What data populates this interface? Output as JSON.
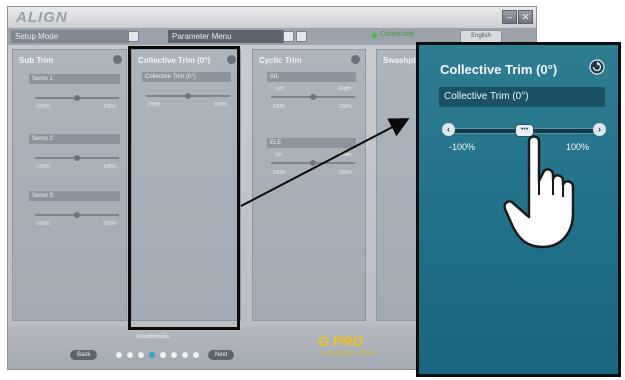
{
  "app": {
    "logo": "ALIGN",
    "window_minimize": "–",
    "window_close": "✕"
  },
  "tabs": [
    {
      "label": "Setup Mode"
    },
    {
      "label": "Parameter Menu"
    }
  ],
  "status": {
    "label": "Connected",
    "button": "English"
  },
  "panels": {
    "subtrim": {
      "title": "Sub Trim",
      "servos": [
        {
          "label": "Servo 1",
          "min": "-100%",
          "max": "100%"
        },
        {
          "label": "Servo 2",
          "min": "-100%",
          "max": "100%"
        },
        {
          "label": "Servo 3",
          "min": "-100%",
          "max": "100%"
        }
      ]
    },
    "collective": {
      "title": "Collective Trim (0°)",
      "field": "Collective Trim (0°)",
      "min": "-100%",
      "max": "100%"
    },
    "cyclic": {
      "title": "Cyclic Trim",
      "groups": [
        {
          "label": "AIL",
          "left": "Left",
          "right": "Right",
          "min": "-100%",
          "max": "100%"
        },
        {
          "label": "ELE",
          "left": "Up",
          "right": "Down",
          "min": "-100%",
          "max": "100%"
        }
      ]
    },
    "setup": {
      "title": "Swashplate"
    }
  },
  "footer": {
    "caption": "Select/Initialize",
    "back": "Back",
    "next": "Next",
    "page_count": 8,
    "current_page": 4,
    "brand": "G PRO",
    "brand_sub": "FLYBARLESS SYSTEM"
  },
  "zoom": {
    "title": "Collective Trim (0°)",
    "field": "Collective Trim (0°)",
    "min": "-100%",
    "max": "100%",
    "knob": "•••",
    "left_arrow": "‹",
    "right_arrow": "›",
    "value_fraction": 0.5
  },
  "colors": {
    "zoom_bg": "#1f6f88",
    "status_green": "#3fbf3a",
    "brand_yellow": "#f1c419",
    "highlight": "#0b0b0b"
  }
}
